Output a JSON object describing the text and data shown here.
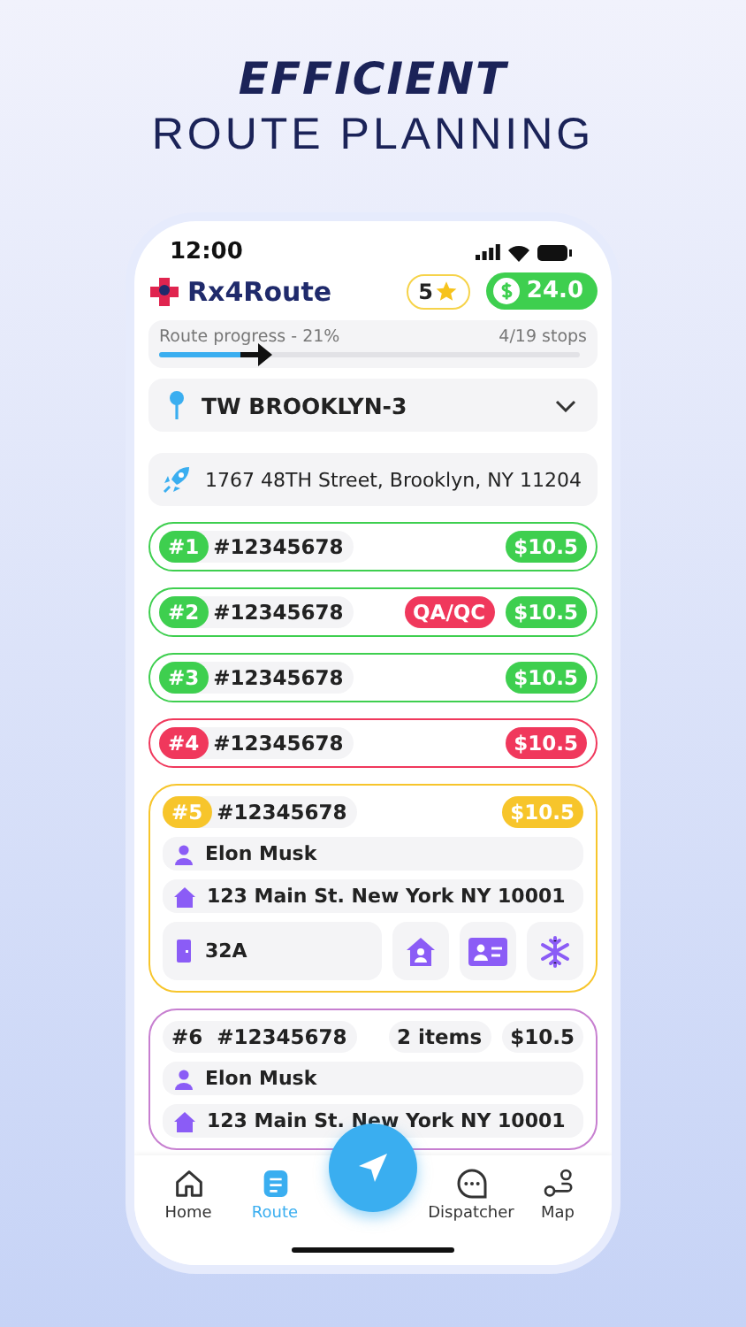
{
  "headline": {
    "title": "EFFICIENT",
    "subtitle": "ROUTE PLANNING"
  },
  "status_bar": {
    "time": "12:00"
  },
  "header": {
    "logo": "Rx4Route",
    "rating": "5",
    "balance": "24.0"
  },
  "progress": {
    "label": "Route progress - 21%",
    "stops": "4/19 stops",
    "level": 0.21
  },
  "route_select": {
    "value": "TW BROOKLYN-3"
  },
  "start_address": "1767 48TH Street, Brooklyn, NY 11204",
  "stops": [
    {
      "kind": "compact",
      "number": "#1",
      "order": "#12345678",
      "price": "$10.5",
      "color": "#3ecf4f",
      "highlight": true
    },
    {
      "kind": "compact",
      "number": "#2",
      "order": "#12345678",
      "tag": "QA/QC",
      "price": "$10.5",
      "color": "#3ecf4f",
      "highlight": true
    },
    {
      "kind": "compact",
      "number": "#3",
      "order": "#12345678",
      "price": "$10.5",
      "color": "#3ecf4f",
      "highlight": true
    },
    {
      "kind": "compact",
      "number": "#4",
      "order": "#12345678",
      "price": "$10.5",
      "color": "#f0385c",
      "highlight": true
    },
    {
      "kind": "expanded",
      "number": "#5",
      "order": "#12345678",
      "price": "$10.5",
      "color": "#f7c52b",
      "highlight": true,
      "name": "Elon Musk",
      "address": "123 Main St. New York NY 10001",
      "apartment": "32A"
    },
    {
      "kind": "expanded",
      "number": "#6",
      "order": "#12345678",
      "items": "2 items",
      "price": "$10.5",
      "color": "#c77fd0",
      "highlight": false,
      "name": "Elon Musk",
      "address": "123 Main St. New York NY 10001"
    }
  ],
  "nav": [
    {
      "label": "Home",
      "kind": "home",
      "selected": false
    },
    {
      "label": "Route",
      "kind": "route",
      "selected": true
    },
    {
      "label": "Dispatcher",
      "kind": "chat",
      "selected": false
    },
    {
      "label": "Map",
      "kind": "map",
      "selected": false
    }
  ]
}
